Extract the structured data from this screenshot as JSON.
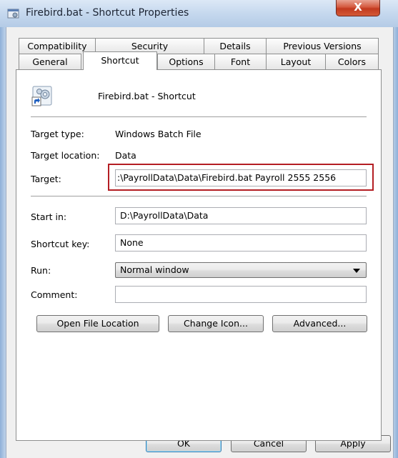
{
  "window": {
    "title": "Firebird.bat - Shortcut Properties",
    "close_label": "X"
  },
  "tabs_row1": [
    {
      "label": "Compatibility"
    },
    {
      "label": "Security"
    },
    {
      "label": "Details"
    },
    {
      "label": "Previous Versions"
    }
  ],
  "tabs_row2": [
    {
      "label": "General"
    },
    {
      "label": "Shortcut",
      "active": true
    },
    {
      "label": "Options"
    },
    {
      "label": "Font"
    },
    {
      "label": "Layout"
    },
    {
      "label": "Colors"
    }
  ],
  "shortcut": {
    "name": "Firebird.bat - Shortcut",
    "target_type_label": "Target type:",
    "target_type_value": "Windows Batch File",
    "target_location_label": "Target location:",
    "target_location_value": "Data",
    "target_label": "Target:",
    "target_value": ":\\PayrollData\\Data\\Firebird.bat Payroll 2555 2556",
    "start_in_label": "Start in:",
    "start_in_value": "D:\\PayrollData\\Data",
    "shortcut_key_label": "Shortcut key:",
    "shortcut_key_value": "None",
    "run_label": "Run:",
    "run_value": "Normal window",
    "comment_label": "Comment:",
    "comment_value": ""
  },
  "buttons": {
    "open_file_location": "Open File Location",
    "change_icon": "Change Icon...",
    "advanced": "Advanced...",
    "ok": "OK",
    "cancel": "Cancel",
    "apply": "Apply"
  },
  "colors": {
    "highlight_border": "#b41e23",
    "close_button": "#c23a1f"
  }
}
